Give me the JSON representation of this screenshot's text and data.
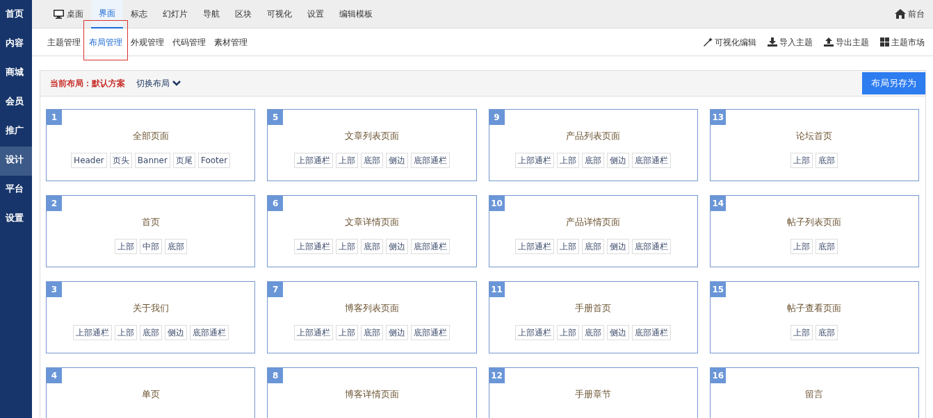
{
  "sidebar": {
    "items": [
      {
        "label": "首页",
        "selected": false
      },
      {
        "label": "内容",
        "selected": false
      },
      {
        "label": "商城",
        "selected": false
      },
      {
        "label": "会员",
        "selected": false
      },
      {
        "label": "推广",
        "selected": false
      },
      {
        "label": "设计",
        "selected": true
      },
      {
        "label": "平台",
        "selected": false
      },
      {
        "label": "设置",
        "selected": false
      }
    ]
  },
  "top_nav": {
    "items": [
      {
        "label": "桌面",
        "kind": "monitor",
        "selected": false
      },
      {
        "label": "界面",
        "selected": true
      },
      {
        "label": "标志",
        "selected": false
      },
      {
        "label": "幻灯片",
        "selected": false
      },
      {
        "label": "导航",
        "selected": false
      },
      {
        "label": "区块",
        "selected": false
      },
      {
        "label": "可视化",
        "selected": false
      },
      {
        "label": "设置",
        "selected": false
      },
      {
        "label": "编辑模板",
        "selected": false
      }
    ],
    "right_link": {
      "label": "前台",
      "kind": "home"
    }
  },
  "sub_nav": {
    "items": [
      {
        "label": "主题管理",
        "selected": false,
        "highlighted": false
      },
      {
        "label": "布局管理",
        "selected": true,
        "highlighted": true
      },
      {
        "label": "外观管理",
        "selected": false,
        "highlighted": false
      },
      {
        "label": "代码管理",
        "selected": false,
        "highlighted": false
      },
      {
        "label": "素材管理",
        "selected": false,
        "highlighted": false
      }
    ],
    "actions": [
      {
        "label": "可视化编辑",
        "kind": "wand"
      },
      {
        "label": "导入主题",
        "kind": "download"
      },
      {
        "label": "导出主题",
        "kind": "upload"
      },
      {
        "label": "主题市场",
        "kind": "grid"
      }
    ]
  },
  "layout_bar": {
    "current": "当前布局：默认方案",
    "switch": "切换布局",
    "save_button": "布局另存为"
  },
  "cards": [
    {
      "number": "1",
      "title": "全部页面",
      "tags": [
        "Header",
        "页头",
        "Banner",
        "页尾",
        "Footer"
      ]
    },
    {
      "number": "2",
      "title": "首页",
      "tags": [
        "上部",
        "中部",
        "底部"
      ]
    },
    {
      "number": "3",
      "title": "关于我们",
      "tags": [
        "上部通栏",
        "上部",
        "底部",
        "侧边",
        "底部通栏"
      ]
    },
    {
      "number": "4",
      "title": "单页"
    },
    {
      "number": "5",
      "title": "文章列表页面",
      "tags": [
        "上部通栏",
        "上部",
        "底部",
        "侧边",
        "底部通栏"
      ]
    },
    {
      "number": "6",
      "title": "文章详情页面",
      "tags": [
        "上部通栏",
        "上部",
        "底部",
        "侧边",
        "底部通栏"
      ]
    },
    {
      "number": "7",
      "title": "博客列表页面",
      "tags": [
        "上部通栏",
        "上部",
        "底部",
        "侧边",
        "底部通栏"
      ]
    },
    {
      "number": "8",
      "title": "博客详情页面"
    },
    {
      "number": "9",
      "title": "产品列表页面",
      "tags": [
        "上部通栏",
        "上部",
        "底部",
        "侧边",
        "底部通栏"
      ]
    },
    {
      "number": "10",
      "title": "产品详情页面",
      "tags": [
        "上部通栏",
        "上部",
        "底部",
        "侧边",
        "底部通栏"
      ]
    },
    {
      "number": "11",
      "title": "手册首页",
      "tags": [
        "上部通栏",
        "上部",
        "底部",
        "侧边",
        "底部通栏"
      ]
    },
    {
      "number": "12",
      "title": "手册章节"
    },
    {
      "number": "13",
      "title": "论坛首页",
      "tags": [
        "上部",
        "底部"
      ]
    },
    {
      "number": "14",
      "title": "帖子列表页面",
      "tags": [
        "上部",
        "底部"
      ]
    },
    {
      "number": "15",
      "title": "帖子查看页面",
      "tags": [
        "上部",
        "底部"
      ]
    },
    {
      "number": "16",
      "title": "留言"
    }
  ]
}
